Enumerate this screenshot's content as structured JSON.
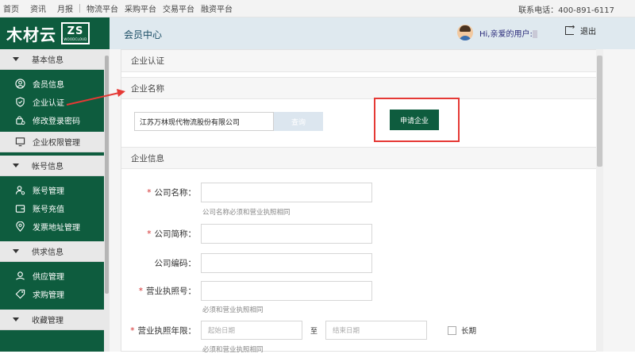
{
  "topnav": {
    "links": [
      "首页",
      "资讯",
      "月报",
      "物流平台",
      "采购平台",
      "交易平台",
      "融资平台"
    ],
    "phone": "联系电话：400-891-6117"
  },
  "header": {
    "logo_text": "木材云",
    "logo_mark": "ZS",
    "logo_sub": "WOODCLOUD",
    "title": "会员中心",
    "greeting": "Hi,亲爱的用户:",
    "logout": "退出"
  },
  "sidebar": {
    "sections": [
      {
        "title": "基本信息",
        "items": [
          "会员信息",
          "企业认证",
          "修改登录密码"
        ]
      },
      {
        "single": "企业权限管理"
      },
      {
        "title": "帐号信息",
        "items": [
          "账号管理",
          "账号充值",
          "发票地址管理"
        ]
      },
      {
        "title": "供求信息",
        "items": [
          "供应管理",
          "求购管理"
        ]
      },
      {
        "title": "收藏管理"
      }
    ]
  },
  "main": {
    "section_cert": "企业认证",
    "section_name": "企业名称",
    "company_value": "江苏万林现代物流股份有限公司",
    "query_label": "查询",
    "apply_label": "申请企业",
    "section_info": "企业信息",
    "form": {
      "company_name_label": "公司名称：",
      "company_name_hint": "公司名称必须和营业执照相同",
      "short_name_label": "公司简称：",
      "code_label": "公司编码：",
      "license_label": "营业执照号：",
      "license_hint": "必须和营业执照相同",
      "license_term_label": "营业执照年限：",
      "start_placeholder": "起始日期",
      "to_label": "至",
      "end_placeholder": "结束日期",
      "long_term_label": "长期",
      "term_hint": "必须和营业执照相同"
    }
  },
  "colors": {
    "brand_green": "#0e5c3e",
    "highlight_red": "#e53935"
  }
}
